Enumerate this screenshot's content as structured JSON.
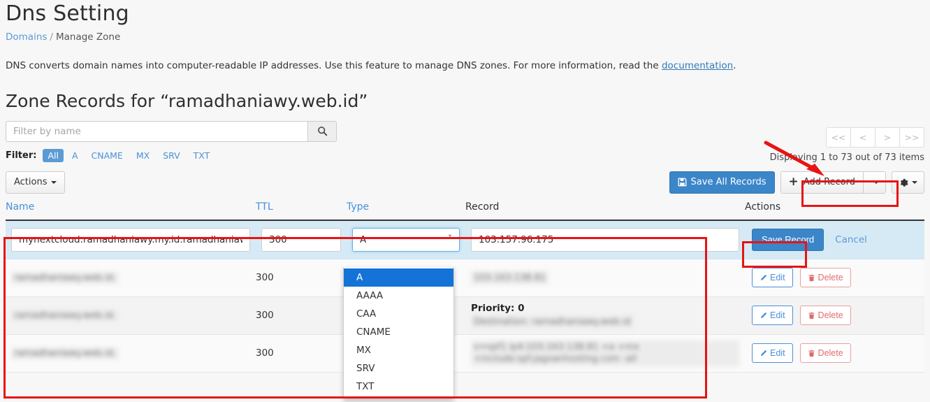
{
  "header": {
    "title": "Dns Setting",
    "breadcrumb": {
      "root": "Domains",
      "separator": "/",
      "current": "Manage Zone"
    }
  },
  "intro": {
    "text_before": "DNS converts domain names into computer-readable IP addresses. Use this feature to manage DNS zones. For more information, read the ",
    "link": "documentation",
    "text_after": "."
  },
  "zone": {
    "title": "Zone Records for “ramadhaniawy.web.id”"
  },
  "search": {
    "placeholder": "Filter by name",
    "value": "",
    "icon": "search-icon"
  },
  "pagination": {
    "first": "<<",
    "prev": "<",
    "next": ">",
    "last": ">>",
    "status": "Displaying 1 to 73 out of 73 items"
  },
  "filters": {
    "label": "Filter:",
    "items": [
      {
        "label": "All",
        "active": true
      },
      {
        "label": "A",
        "active": false
      },
      {
        "label": "CNAME",
        "active": false
      },
      {
        "label": "MX",
        "active": false
      },
      {
        "label": "SRV",
        "active": false
      },
      {
        "label": "TXT",
        "active": false
      }
    ]
  },
  "toolbar": {
    "actions_label": "Actions",
    "save_all_label": "Save All Records",
    "save_all_icon": "floppy-disk-icon",
    "add_record_label": "Add Record",
    "add_record_icon": "plus-icon",
    "split_caret_icon": "caret-down-icon",
    "gear_icon": "gear-icon",
    "accent_color": "#3b86c8"
  },
  "table": {
    "columns": [
      "Name",
      "TTL",
      "Type",
      "Record",
      "Actions"
    ],
    "edit_row": {
      "name_value": "mynextcloud.ramadhaniawy.my.id.ramadhaniaw",
      "ttl_value": "300",
      "type_value": "A",
      "record_value": "103.157.96.175",
      "save_label": "Save Record",
      "cancel_label": "Cancel"
    },
    "type_options": [
      "A",
      "AAAA",
      "CAA",
      "CNAME",
      "MX",
      "SRV",
      "TXT"
    ],
    "type_selected": "A",
    "rows": [
      {
        "name": "ramadhaniawy.web.id.",
        "ttl": "300",
        "record": "103.163.138.81",
        "record_prefix": "",
        "priority": "",
        "destination": "",
        "edit_label": "Edit",
        "delete_label": "Delete"
      },
      {
        "name": "ramadhaniawy.web.id.",
        "ttl": "300",
        "record": "",
        "priority_label": "Priority:",
        "priority": "0",
        "destination": "Destination: ramadhaniawy.web.id",
        "edit_label": "Edit",
        "delete_label": "Delete"
      },
      {
        "name": "ramadhaniawy.web.id.",
        "ttl": "300",
        "record": "v=spf1 ip4:103.163.138.81 +a +mx +include:spf.jagoanhosting.com -all",
        "record_visible_tail": "anhosti",
        "edit_label": "Edit",
        "delete_label": "Delete"
      }
    ]
  },
  "annotations": {
    "color": "#e81313",
    "arrow": "red-arrow",
    "boxes": [
      "add-record-button",
      "records-table",
      "save-record-button"
    ]
  }
}
